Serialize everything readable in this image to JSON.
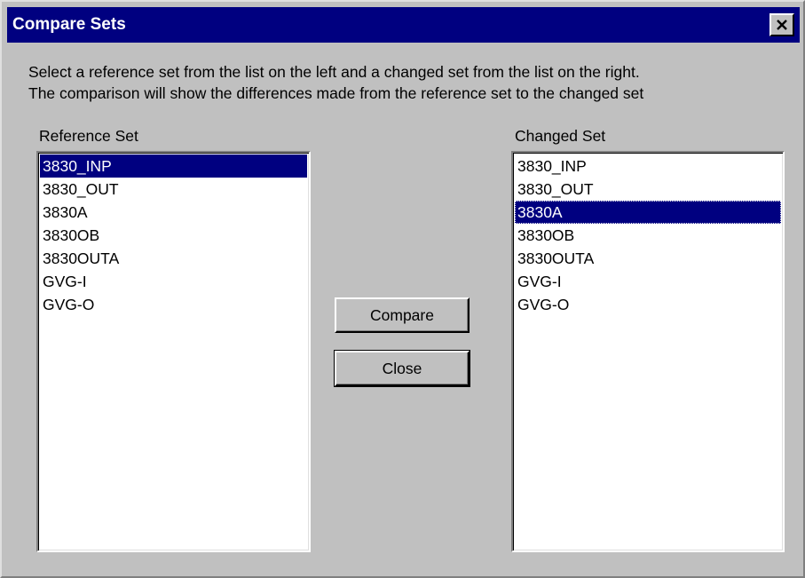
{
  "window": {
    "title": "Compare Sets",
    "close_icon": "close-icon"
  },
  "instructions": {
    "line1": "Select a reference set from the list on the left and a changed set from the list on the right.",
    "line2": "The comparison will show the differences made from the reference set to the changed set"
  },
  "reference": {
    "label": "Reference Set",
    "items": [
      "3830_INP",
      "3830_OUT",
      "3830A",
      "3830OB",
      "3830OUTA",
      "GVG-I",
      "GVG-O"
    ],
    "selected": "3830_INP"
  },
  "changed": {
    "label": "Changed Set",
    "items": [
      "3830_INP",
      "3830_OUT",
      "3830A",
      "3830OB",
      "3830OUTA",
      "GVG-I",
      "GVG-O"
    ],
    "selected": "3830A"
  },
  "buttons": {
    "compare": "Compare",
    "close": "Close"
  },
  "colors": {
    "titlebar": "#000080",
    "selection": "#000080",
    "face": "#c0c0c0"
  }
}
